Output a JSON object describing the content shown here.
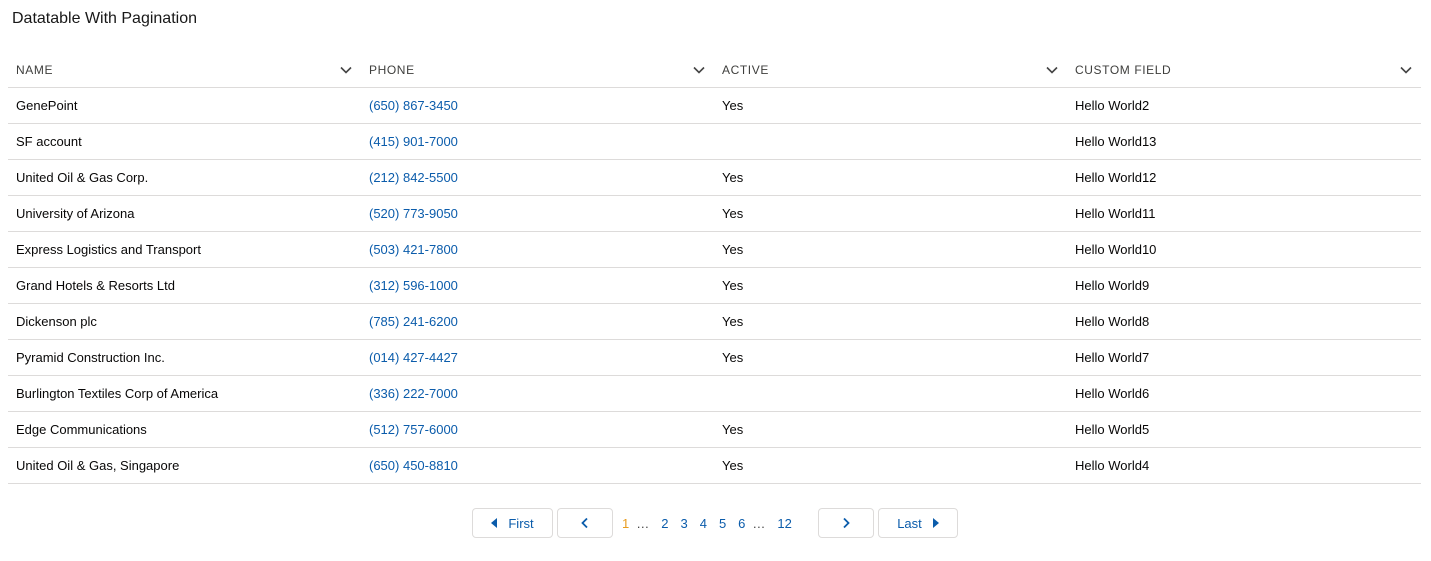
{
  "card": {
    "title": "Datatable With Pagination"
  },
  "table": {
    "columns": [
      {
        "label": "NAME"
      },
      {
        "label": "PHONE"
      },
      {
        "label": "ACTIVE"
      },
      {
        "label": "CUSTOM FIELD"
      }
    ],
    "rows": [
      {
        "name": "GenePoint",
        "phone": "(650) 867-3450",
        "active": "Yes",
        "custom": "Hello World2"
      },
      {
        "name": "SF account",
        "phone": "(415) 901-7000",
        "active": "",
        "custom": "Hello World13"
      },
      {
        "name": "United Oil & Gas Corp.",
        "phone": "(212) 842-5500",
        "active": "Yes",
        "custom": "Hello World12"
      },
      {
        "name": "University of Arizona",
        "phone": "(520) 773-9050",
        "active": "Yes",
        "custom": "Hello World11"
      },
      {
        "name": "Express Logistics and Transport",
        "phone": "(503) 421-7800",
        "active": "Yes",
        "custom": "Hello World10"
      },
      {
        "name": "Grand Hotels & Resorts Ltd",
        "phone": "(312) 596-1000",
        "active": "Yes",
        "custom": "Hello World9"
      },
      {
        "name": "Dickenson plc",
        "phone": "(785) 241-6200",
        "active": "Yes",
        "custom": "Hello World8"
      },
      {
        "name": "Pyramid Construction Inc.",
        "phone": "(014) 427-4427",
        "active": "Yes",
        "custom": "Hello World7"
      },
      {
        "name": "Burlington Textiles Corp of America",
        "phone": "(336) 222-7000",
        "active": "",
        "custom": "Hello World6"
      },
      {
        "name": "Edge Communications",
        "phone": "(512) 757-6000",
        "active": "Yes",
        "custom": "Hello World5"
      },
      {
        "name": "United Oil & Gas, Singapore",
        "phone": "(650) 450-8810",
        "active": "Yes",
        "custom": "Hello World4"
      }
    ]
  },
  "pagination": {
    "first_label": "First",
    "last_label": "Last",
    "current_page": "1",
    "pages": [
      "1",
      "…",
      "2",
      "3",
      "4",
      "5",
      "6",
      "…",
      "12"
    ],
    "icons": {
      "first": "caret-left-icon",
      "prev": "chevron-left-icon",
      "next": "chevron-right-icon",
      "last": "caret-right-icon"
    }
  },
  "colors": {
    "link": "#0b5cab",
    "current_page": "#e89c1f",
    "border": "#dddbda"
  }
}
